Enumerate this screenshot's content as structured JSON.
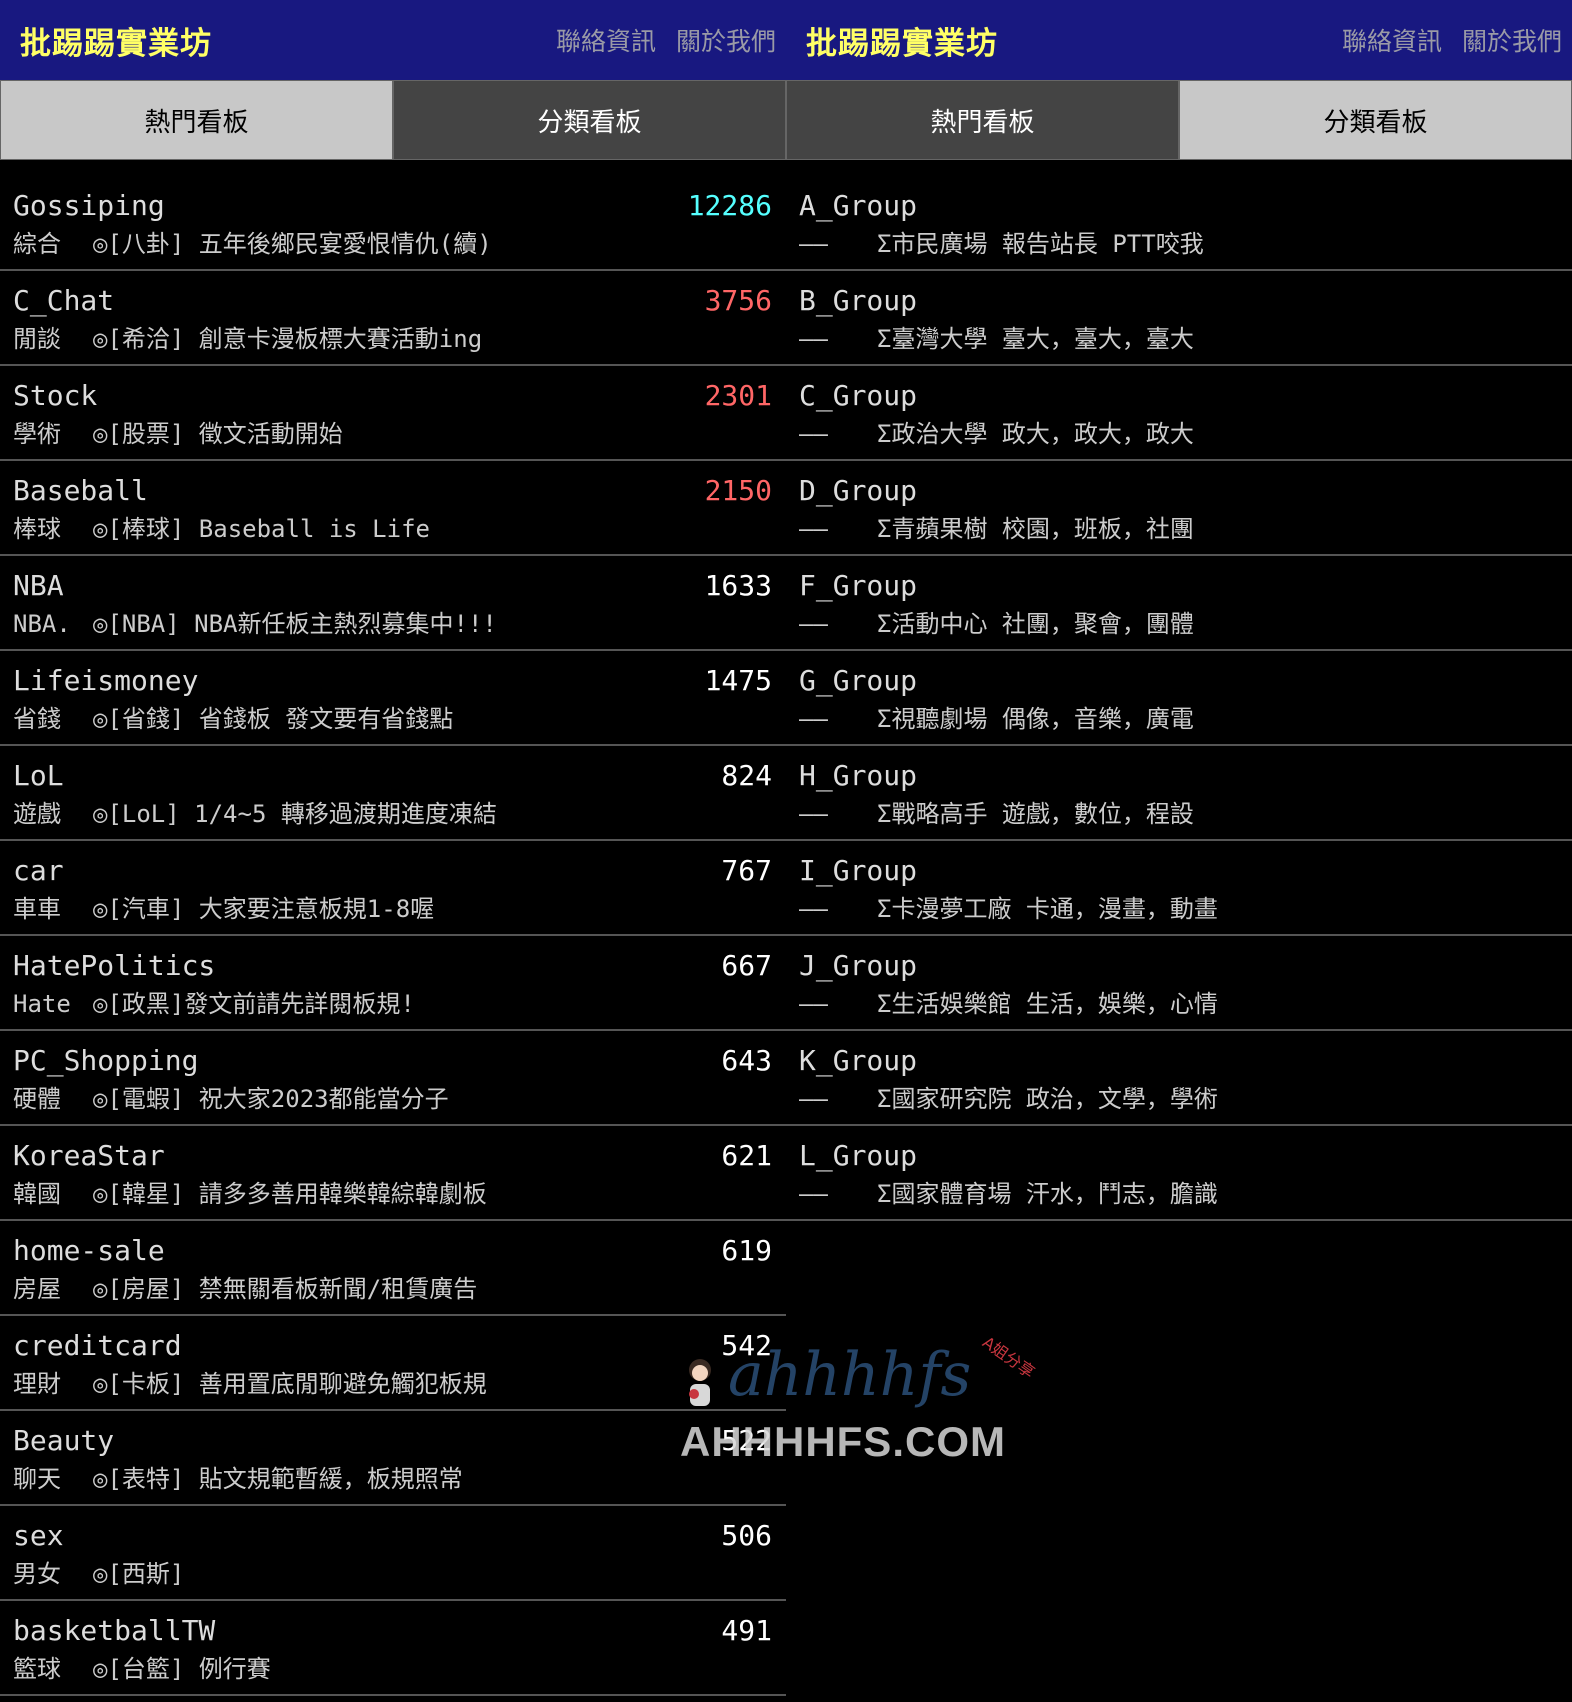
{
  "left": {
    "brand": "批踢踢實業坊",
    "links": [
      "聯絡資訊",
      "關於我們"
    ],
    "tabs": [
      {
        "label": "熱門看板",
        "active": true
      },
      {
        "label": "分類看板",
        "active": false
      }
    ],
    "boards": [
      {
        "name": "Gossiping",
        "count": "12286",
        "count_color": "cyan",
        "class": "綜合",
        "title": "◎[八卦] 五年後鄉民宴愛恨情仇(續)"
      },
      {
        "name": "C_Chat",
        "count": "3756",
        "count_color": "red",
        "class": "閒談",
        "title": "◎[希洽] 創意卡漫板標大賽活動ing"
      },
      {
        "name": "Stock",
        "count": "2301",
        "count_color": "red",
        "class": "學術",
        "title": "◎[股票] 徵文活動開始"
      },
      {
        "name": "Baseball",
        "count": "2150",
        "count_color": "red",
        "class": "棒球",
        "title": "◎[棒球] Baseball is Life"
      },
      {
        "name": "NBA",
        "count": "1633",
        "count_color": "white",
        "class": "NBA.",
        "title": "◎[NBA] NBA新任板主熱烈募集中!!!"
      },
      {
        "name": "Lifeismoney",
        "count": "1475",
        "count_color": "white",
        "class": "省錢",
        "title": "◎[省錢] 省錢板 發文要有省錢點"
      },
      {
        "name": "LoL",
        "count": "824",
        "count_color": "white",
        "class": "遊戲",
        "title": "◎[LoL] 1/4~5 轉移過渡期進度凍結"
      },
      {
        "name": "car",
        "count": "767",
        "count_color": "white",
        "class": "車車",
        "title": "◎[汽車] 大家要注意板規1-8喔"
      },
      {
        "name": "HatePolitics",
        "count": "667",
        "count_color": "white",
        "class": "Hate",
        "title": "◎[政黑]發文前請先詳閱板規!"
      },
      {
        "name": "PC_Shopping",
        "count": "643",
        "count_color": "white",
        "class": "硬體",
        "title": "◎[電蝦] 祝大家2023都能當分子"
      },
      {
        "name": "KoreaStar",
        "count": "621",
        "count_color": "white",
        "class": "韓國",
        "title": "◎[韓星] 請多多善用韓樂韓綜韓劇板"
      },
      {
        "name": "home-sale",
        "count": "619",
        "count_color": "white",
        "class": "房屋",
        "title": "◎[房屋] 禁無關看板新聞/租賃廣告"
      },
      {
        "name": "creditcard",
        "count": "542",
        "count_color": "white",
        "class": "理財",
        "title": "◎[卡板] 善用置底閒聊避免觸犯板規"
      },
      {
        "name": "Beauty",
        "count": "522",
        "count_color": "white",
        "class": "聊天",
        "title": "◎[表特] 貼文規範暫緩，板規照常"
      },
      {
        "name": "sex",
        "count": "506",
        "count_color": "white",
        "class": "男女",
        "title": "◎[西斯]"
      },
      {
        "name": "basketballTW",
        "count": "491",
        "count_color": "white",
        "class": "籃球",
        "title": "◎[台籃] 例行賽"
      }
    ]
  },
  "right": {
    "brand": "批踢踢實業坊",
    "links": [
      "聯絡資訊",
      "關於我們"
    ],
    "tabs": [
      {
        "label": "熱門看板",
        "active": false
      },
      {
        "label": "分類看板",
        "active": true
      }
    ],
    "groups": [
      {
        "name": "A_Group",
        "dash": "——",
        "title": "Σ市民廣場 報告站長 PTT咬我"
      },
      {
        "name": "B_Group",
        "dash": "——",
        "title": "Σ臺灣大學 臺大，臺大，臺大"
      },
      {
        "name": "C_Group",
        "dash": "——",
        "title": "Σ政治大學 政大，政大，政大"
      },
      {
        "name": "D_Group",
        "dash": "——",
        "title": "Σ青蘋果樹 校園，班板，社團"
      },
      {
        "name": "F_Group",
        "dash": "——",
        "title": "Σ活動中心 社團，聚會，團體"
      },
      {
        "name": "G_Group",
        "dash": "——",
        "title": "Σ視聽劇場 偶像，音樂，廣電"
      },
      {
        "name": "H_Group",
        "dash": "——",
        "title": "Σ戰略高手 遊戲，數位，程設"
      },
      {
        "name": "I_Group",
        "dash": "——",
        "title": "Σ卡漫夢工廠 卡通，漫畫，動畫"
      },
      {
        "name": "J_Group",
        "dash": "——",
        "title": "Σ生活娛樂館 生活，娛樂，心情"
      },
      {
        "name": "K_Group",
        "dash": "——",
        "title": "Σ國家研究院 政治，文學，學術"
      },
      {
        "name": "L_Group",
        "dash": "——",
        "title": "Σ國家體育場 汗水，鬥志，膽識"
      }
    ]
  },
  "watermark": {
    "logo_text": "ahhhhfs",
    "domain": "AHHHHFS.COM",
    "small": "A姐分享"
  }
}
